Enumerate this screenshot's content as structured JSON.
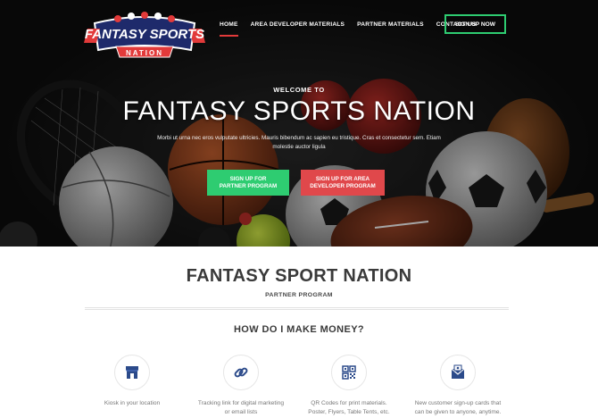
{
  "brand": {
    "logo_top": "FANTASY SPORTS",
    "logo_bottom": "NATION",
    "colors": {
      "red": "#e23a3a",
      "navy": "#1e2a6b",
      "green": "#2ecc71",
      "cta_red": "#e0484b"
    }
  },
  "nav": {
    "items": [
      {
        "label": "HOME",
        "active": true
      },
      {
        "label": "AREA DEVELOPER MATERIALS",
        "active": false
      },
      {
        "label": "PARTNER MATERIALS",
        "active": false
      },
      {
        "label": "CONTACT US",
        "active": false
      }
    ],
    "signup_label": "SIGN UP NOW"
  },
  "hero": {
    "welcome": "WELCOME TO",
    "title": "FANTASY SPORTS NATION",
    "subtitle": "Morbi ut urna nec eros vulputate ultricies. Mauris bibendum ac sapien eu tristique. Cras et consectetur sem. Etiam molestie auctor ligula",
    "cta_partner_line1": "SIGN UP FOR",
    "cta_partner_line2": "PARTNER PROGRAM",
    "cta_developer_line1": "SIGN UP FOR AREA",
    "cta_developer_line2": "DEVELOPER PROGRAM"
  },
  "content": {
    "title": "FANTASY SPORT NATION",
    "subtitle": "PARTNER PROGRAM",
    "how_title": "HOW DO I MAKE MONEY?",
    "features": [
      {
        "icon": "store-icon",
        "line1": "Kiosk in your location",
        "line2": ""
      },
      {
        "icon": "link-icon",
        "line1": "Tracking link for digital marketing",
        "line2": "or email lists"
      },
      {
        "icon": "qr-code-icon",
        "line1": "QR Codes for print materials.",
        "line2": "Poster, Flyers, Table Tents, etc."
      },
      {
        "icon": "card-icon",
        "line1": "New customer sign-up cards that",
        "line2": "can be given to anyone, anytime."
      }
    ]
  }
}
